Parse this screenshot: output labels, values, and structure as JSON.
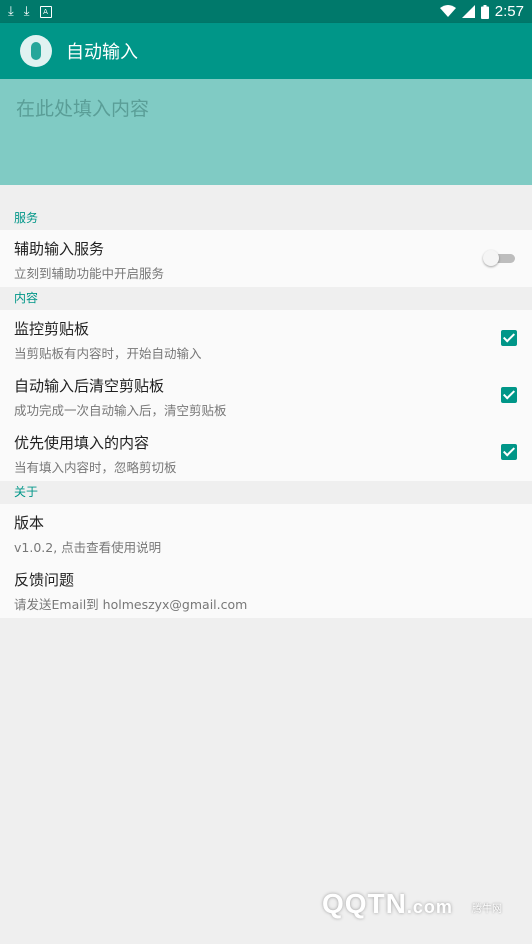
{
  "statusbar": {
    "time": "2:57",
    "icons": [
      "download-icon",
      "download-icon",
      "notification-box-icon",
      "wifi-icon",
      "signal-icon",
      "battery-icon"
    ]
  },
  "appbar": {
    "title": "自动输入"
  },
  "input": {
    "placeholder": "在此处填入内容",
    "value": ""
  },
  "settings": {
    "categories": [
      {
        "title": "服务",
        "items": [
          {
            "title": "辅助输入服务",
            "summary": "立刻到辅助功能中开启服务",
            "control": "switch",
            "checked": false
          }
        ]
      },
      {
        "title": "内容",
        "items": [
          {
            "title": "监控剪贴板",
            "summary": "当剪贴板有内容时，开始自动输入",
            "control": "checkbox",
            "checked": true
          },
          {
            "title": "自动输入后清空剪贴板",
            "summary": "成功完成一次自动输入后，清空剪贴板",
            "control": "checkbox",
            "checked": true
          },
          {
            "title": "优先使用填入的内容",
            "summary": "当有填入内容时，忽略剪切板",
            "control": "checkbox",
            "checked": true
          }
        ]
      },
      {
        "title": "关于",
        "items": [
          {
            "title": "版本",
            "summary": "v1.0.2, 点击查看使用说明"
          },
          {
            "title": "反馈问题",
            "summary": "请发送Email到 holmeszyx@gmail.com"
          }
        ]
      }
    ]
  },
  "watermark": {
    "logo": "QQTN",
    "suffix": ".com",
    "small": "腾牛网"
  },
  "colors": {
    "primary": "#009688",
    "primary_dark": "#00796b",
    "input_bg": "#80cbc4",
    "accent": "#009688"
  }
}
